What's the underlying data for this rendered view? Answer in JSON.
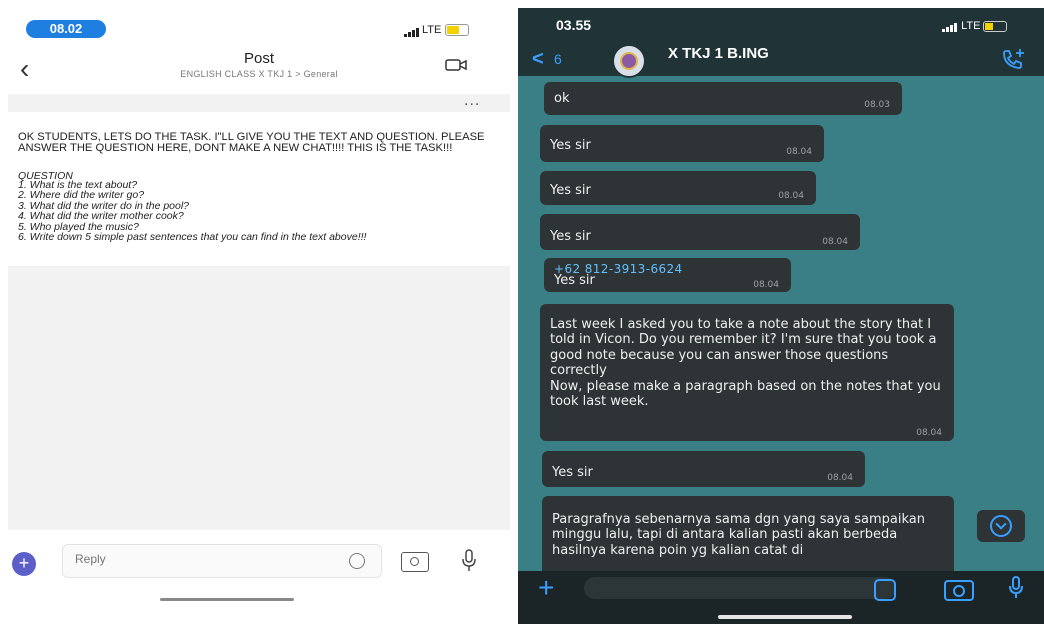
{
  "left": {
    "status": {
      "time": "08.02",
      "network": "LTE"
    },
    "header": {
      "title": "Post",
      "subtitle": "ENGLISH CLASS X TKJ 1 > General"
    },
    "more": "...",
    "post": {
      "text": "OK STUDENTS, LETS DO THE TASK. I\"LL GIVE YOU THE TEXT AND QUESTION. PLEASE ANSWER THE QUESTION HERE, DONT MAKE A NEW CHAT!!!! THIS IS THE TASK!!!",
      "question_heading": "QUESTION",
      "questions": [
        "1. What is the text about?",
        "2. Where did the writer go?",
        "3. What did the writer do in the pool?",
        "4. What did the writer mother cook?",
        "5. Who played the music?",
        "6. Write down 5 simple past sentences that you can find in the text above!!!"
      ]
    },
    "composer": {
      "placeholder": "Reply",
      "plus": "+"
    }
  },
  "right": {
    "status": {
      "time": "03.55",
      "network": "LTE"
    },
    "header": {
      "back": "<",
      "back_count": "6",
      "chat_name": "X TKJ 1 B.ING"
    },
    "messages": [
      {
        "text": "ok",
        "time": "08.03"
      },
      {
        "text": "Yes sir",
        "time": "08.04"
      },
      {
        "text": "Yes sir",
        "time": "08.04"
      },
      {
        "text": "Yes sir",
        "time": "08.04"
      },
      {
        "sender": "+62 812-3913-6624",
        "text": "Yes sir",
        "time": "08.04"
      },
      {
        "text": "Last week I asked you to take a note about the story that I told in Vicon. Do you remember it? I'm sure that you took a good note because you can answer those questions correctly\nNow, please make a paragraph based on the notes that you took last week.",
        "time": "08.04"
      },
      {
        "text": "Yes sir",
        "time": "08.04"
      },
      {
        "text": "Paragrafnya sebenarnya sama dgn yang saya sampaikan minggu lalu, tapi di antara kalian pasti akan berbeda hasilnya karena poin yg kalian catat di"
      }
    ],
    "composer": {
      "plus": "+"
    }
  }
}
